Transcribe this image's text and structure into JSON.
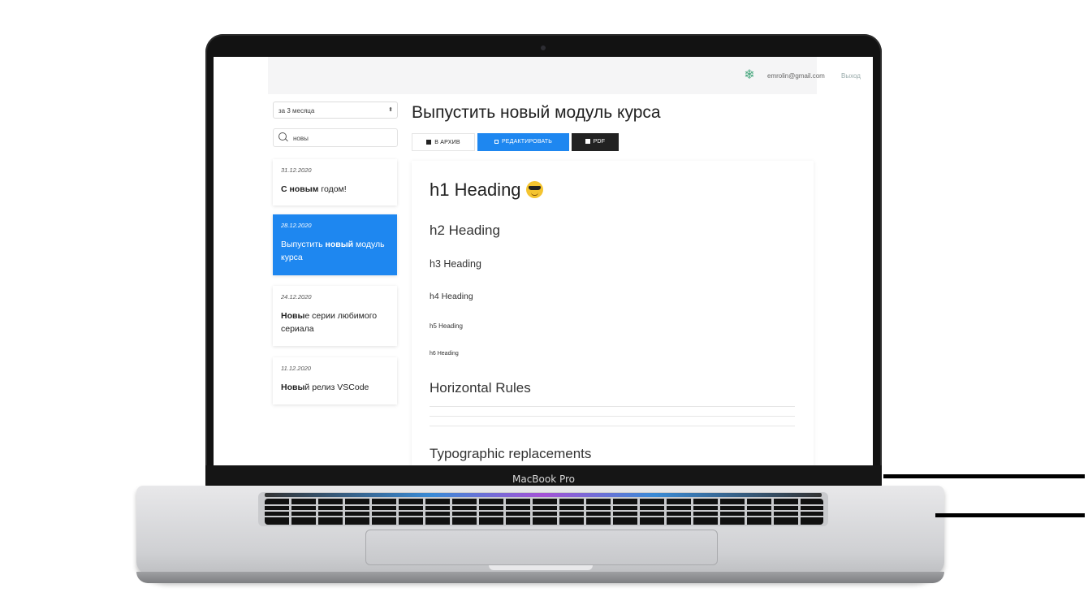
{
  "device": {
    "brand_label": "MacBook Pro"
  },
  "header": {
    "email": "emrolin@gmail.com",
    "logout_label": "Выход",
    "logo_icon": "snowflake-icon"
  },
  "sidebar": {
    "period_select": {
      "value": "за 3 месяца"
    },
    "search": {
      "value": "новы"
    },
    "items": [
      {
        "date": "31.12.2020",
        "title_bold": "С новым",
        "title_rest": " годом!",
        "active": false
      },
      {
        "date": "28.12.2020",
        "title_plain": "Выпустить ",
        "title_bold": "новый",
        "title_rest": " модуль курса",
        "active": true
      },
      {
        "date": "24.12.2020",
        "title_bold": "Новы",
        "title_rest": "е серии любимого сериала",
        "active": false
      },
      {
        "date": "11.12.2020",
        "title_bold": "Новы",
        "title_rest": "й релиз VSCode",
        "active": false
      }
    ]
  },
  "main": {
    "title": "Выпустить новый модуль курса",
    "buttons": {
      "archive": "В АРХИВ",
      "edit": "РЕДАКТИРОВАТЬ",
      "pdf": "PDF"
    },
    "content": {
      "h1": "h1 Heading",
      "h2": "h2 Heading",
      "h3": "h3 Heading",
      "h4": "h4 Heading",
      "h5": "h5 Heading",
      "h6": "h6 Heading",
      "horizontal_rules": "Horizontal Rules",
      "typographic": "Typographic replacements"
    }
  },
  "colors": {
    "accent": "#1e87f0",
    "dark_button": "#222222"
  }
}
